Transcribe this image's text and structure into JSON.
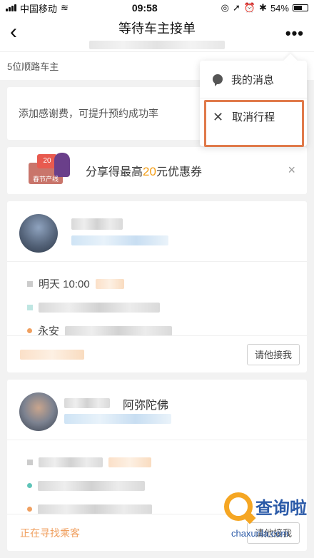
{
  "status_bar": {
    "carrier": "中国移动",
    "time": "09:58",
    "battery": "54%"
  },
  "nav": {
    "back_icon": "‹",
    "title": "等待车主接单",
    "more_icon": "•••"
  },
  "info": {
    "drivers_count_text": "5位顺路车主"
  },
  "tip": {
    "text": "添加感谢费，可提升预约成功率"
  },
  "promo": {
    "coupon_amount": "20",
    "coupon_label": "春节产线",
    "text_before": "分享得最高",
    "highlight": "20",
    "text_after": "元优惠券",
    "close_icon": "×"
  },
  "drivers": [
    {
      "name_partial": "",
      "time_text": "明天 10:00",
      "destination_partial": "永安",
      "status": "",
      "button_label": "请他接我"
    },
    {
      "name_partial": "阿弥陀佛",
      "time_text": "",
      "destination_partial": "",
      "status": "正在寻找乘客",
      "button_label": "请他接我"
    }
  ],
  "popup": {
    "items": [
      {
        "icon": "message-icon",
        "label": "我的消息"
      },
      {
        "icon": "close-icon",
        "label": "取消行程"
      }
    ]
  },
  "watermark": {
    "text": "查询啦",
    "url": "chaxunla.com"
  },
  "colors": {
    "accent_orange": "#f39c12",
    "highlight_border": "#e07a4a",
    "status_orange": "#f0a060"
  }
}
